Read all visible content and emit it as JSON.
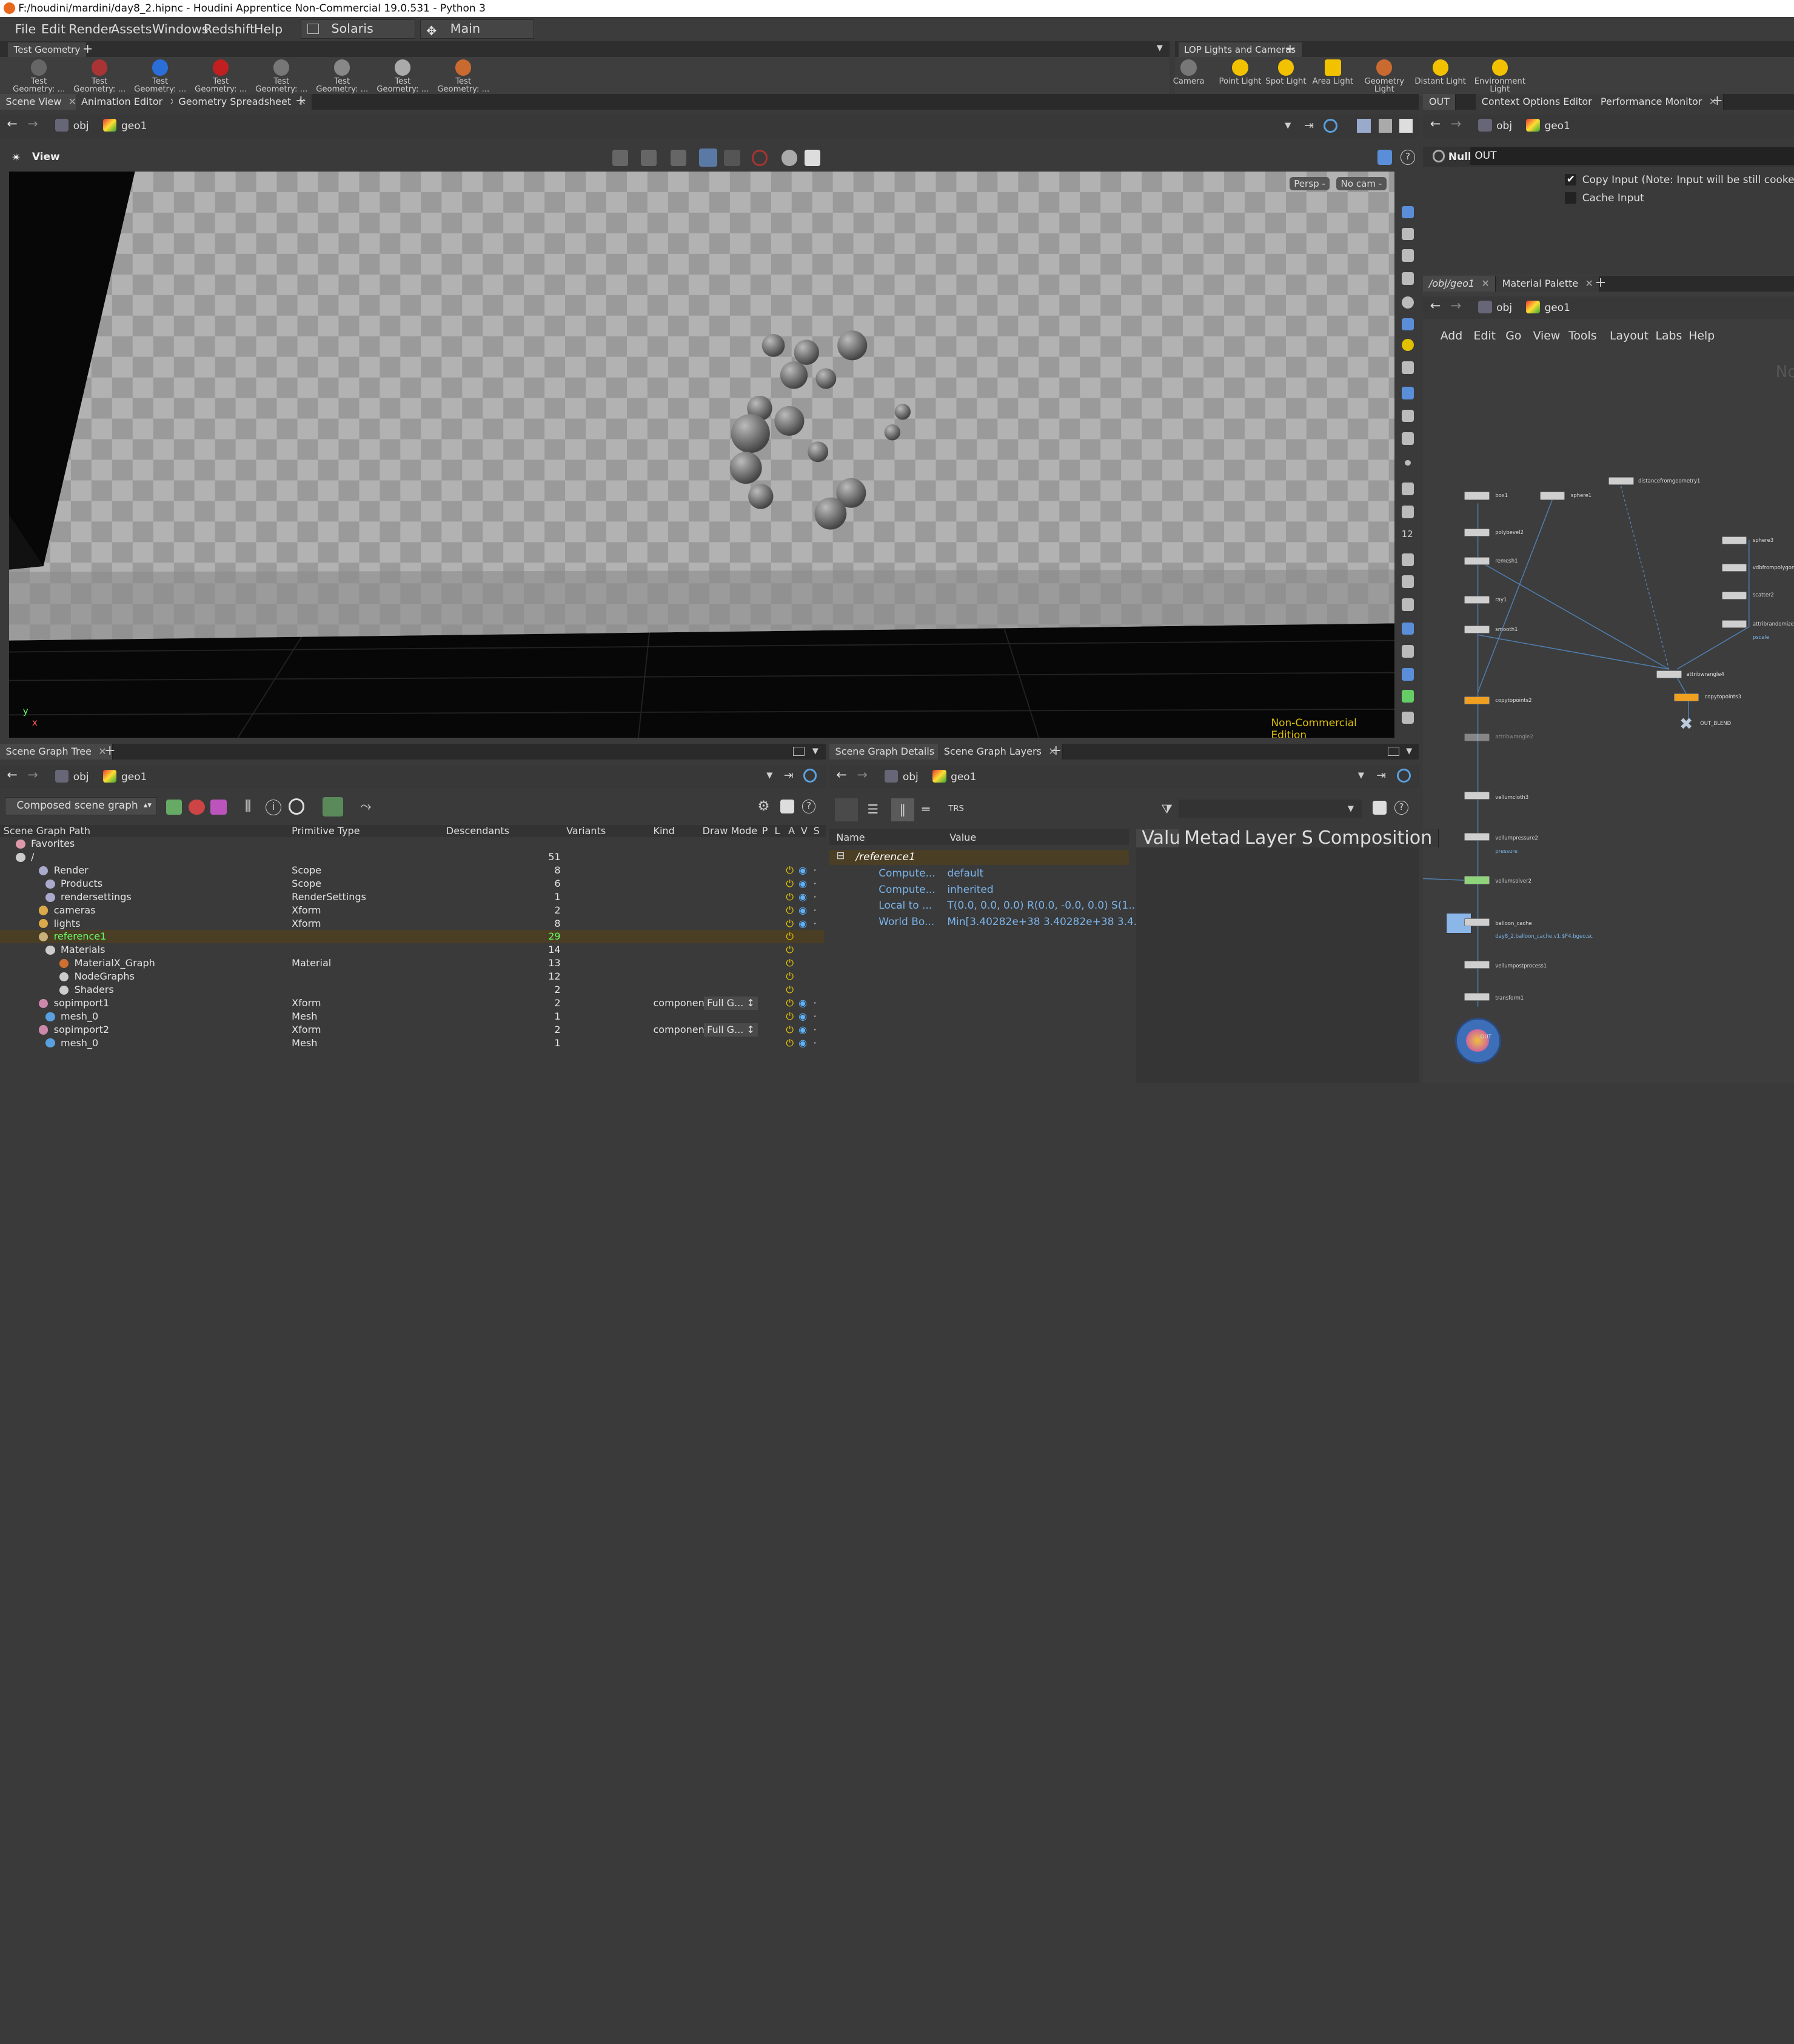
{
  "window": {
    "title": "F:/houdini/mardini/day8_2.hipnc - Houdini Apprentice Non-Commercial 19.0.531 - Python 3"
  },
  "menu": {
    "items": [
      "File",
      "Edit",
      "Render",
      "Assets",
      "Windows",
      "Redshift",
      "Help"
    ],
    "desktop": "Solaris",
    "context": "Main"
  },
  "shelf_left": {
    "tab": "Test Geometry",
    "tools": [
      "Test Geometry: ...",
      "Test Geometry: ...",
      "Test Geometry: ...",
      "Test Geometry: ...",
      "Test Geometry: ...",
      "Test Geometry: ...",
      "Test Geometry: ...",
      "Test Geometry: ..."
    ]
  },
  "shelf_right": {
    "tab": "LOP Lights and Cameras",
    "tools": [
      "Camera",
      "Point Light",
      "Spot Light",
      "Area Light",
      "Geometry Light",
      "Distant Light",
      "Environment Light"
    ]
  },
  "scene_tabs": [
    "Scene View",
    "Animation Editor",
    "Geometry Spreadsheet"
  ],
  "right_tabs": [
    "OUT",
    "Context Options Editor",
    "Performance Monitor"
  ],
  "path": {
    "obj": "obj",
    "geo": "geo1"
  },
  "viewport": {
    "label": "View",
    "persp": "Persp -",
    "cam": "No cam -",
    "watermark": "Non-Commercial Edition",
    "axis_y": "y",
    "axis_x": "x"
  },
  "params": {
    "type": "Null",
    "name": "OUT",
    "copy_input": "Copy Input (Note: Input will be still cooked if di",
    "cache_input": "Cache Input"
  },
  "network": {
    "tabs": [
      "/obj/geo1",
      "Material Palette"
    ],
    "menu": [
      "Add",
      "Edit",
      "Go",
      "View",
      "Tools",
      "Layout",
      "Labs",
      "Help"
    ],
    "corner": "No",
    "nodes": [
      "box1",
      "sphere1",
      "distancefromgeometry1",
      "polybevel2",
      "remesh1",
      "ray1",
      "smooth1",
      "sphere3",
      "vdbfrompolygons",
      "scatter2",
      "attribrandomize",
      "pscale",
      "attribwrangle4",
      "copytopoints2",
      "copytopoints3",
      "OUT_BLEND",
      "attribwrangle2",
      "vellumcloth3",
      "vellumpressure2",
      "pressure",
      "vellumsolver2",
      "balloon_cache",
      "day8_2.balloon_cache.v1.$F4.bgeo.sc",
      "vellumpostprocess1",
      "transform1",
      "OUT"
    ]
  },
  "tree": {
    "tab": "Scene Graph Tree",
    "mode": "Composed scene graph",
    "columns": [
      "Scene Graph Path",
      "Primitive Type",
      "Descendants",
      "Variants",
      "Kind",
      "Draw Mode",
      "P",
      "L",
      "A",
      "V",
      "S"
    ],
    "rows": [
      {
        "name": "Favorites",
        "type": "",
        "desc": "",
        "kind": "",
        "draw": ""
      },
      {
        "name": "/",
        "type": "",
        "desc": "51",
        "kind": "",
        "draw": ""
      },
      {
        "name": "Render",
        "type": "Scope",
        "desc": "8",
        "kind": "",
        "draw": ""
      },
      {
        "name": "Products",
        "type": "Scope",
        "desc": "6",
        "kind": "",
        "draw": ""
      },
      {
        "name": "rendersettings",
        "type": "RenderSettings",
        "desc": "1",
        "kind": "",
        "draw": ""
      },
      {
        "name": "cameras",
        "type": "Xform",
        "desc": "2",
        "kind": "",
        "draw": ""
      },
      {
        "name": "lights",
        "type": "Xform",
        "desc": "8",
        "kind": "",
        "draw": ""
      },
      {
        "name": "reference1",
        "type": "",
        "desc": "29",
        "kind": "",
        "draw": ""
      },
      {
        "name": "Materials",
        "type": "",
        "desc": "14",
        "kind": "",
        "draw": ""
      },
      {
        "name": "MaterialX_Graph",
        "type": "Material",
        "desc": "13",
        "kind": "",
        "draw": ""
      },
      {
        "name": "NodeGraphs",
        "type": "",
        "desc": "12",
        "kind": "",
        "draw": ""
      },
      {
        "name": "Shaders",
        "type": "",
        "desc": "2",
        "kind": "",
        "draw": ""
      },
      {
        "name": "sopimport1",
        "type": "Xform",
        "desc": "2",
        "kind": "componen",
        "draw": "Full G..."
      },
      {
        "name": "mesh_0",
        "type": "Mesh",
        "desc": "1",
        "kind": "",
        "draw": ""
      },
      {
        "name": "sopimport2",
        "type": "Xform",
        "desc": "2",
        "kind": "componen",
        "draw": "Full G..."
      },
      {
        "name": "mesh_0",
        "type": "Mesh",
        "desc": "1",
        "kind": "",
        "draw": ""
      }
    ]
  },
  "details": {
    "tabs": [
      "Scene Graph Details",
      "Scene Graph Layers"
    ],
    "columns": [
      "Name",
      "Value"
    ],
    "prim": "/reference1",
    "rows": [
      {
        "name": "Compute...",
        "value": "default"
      },
      {
        "name": "Compute...",
        "value": "inherited"
      },
      {
        "name": "Local to ...",
        "value": "T(0.0, 0.0, 0.0) R(0.0, -0.0, 0.0) S(1...."
      },
      {
        "name": "World Bo...",
        "value": "Min[3.40282e+38 3.40282e+38 3.4..."
      }
    ],
    "subtabs": [
      "Value",
      "Metadata",
      "Layer Stack",
      "Composition"
    ],
    "trs": "TRS"
  }
}
